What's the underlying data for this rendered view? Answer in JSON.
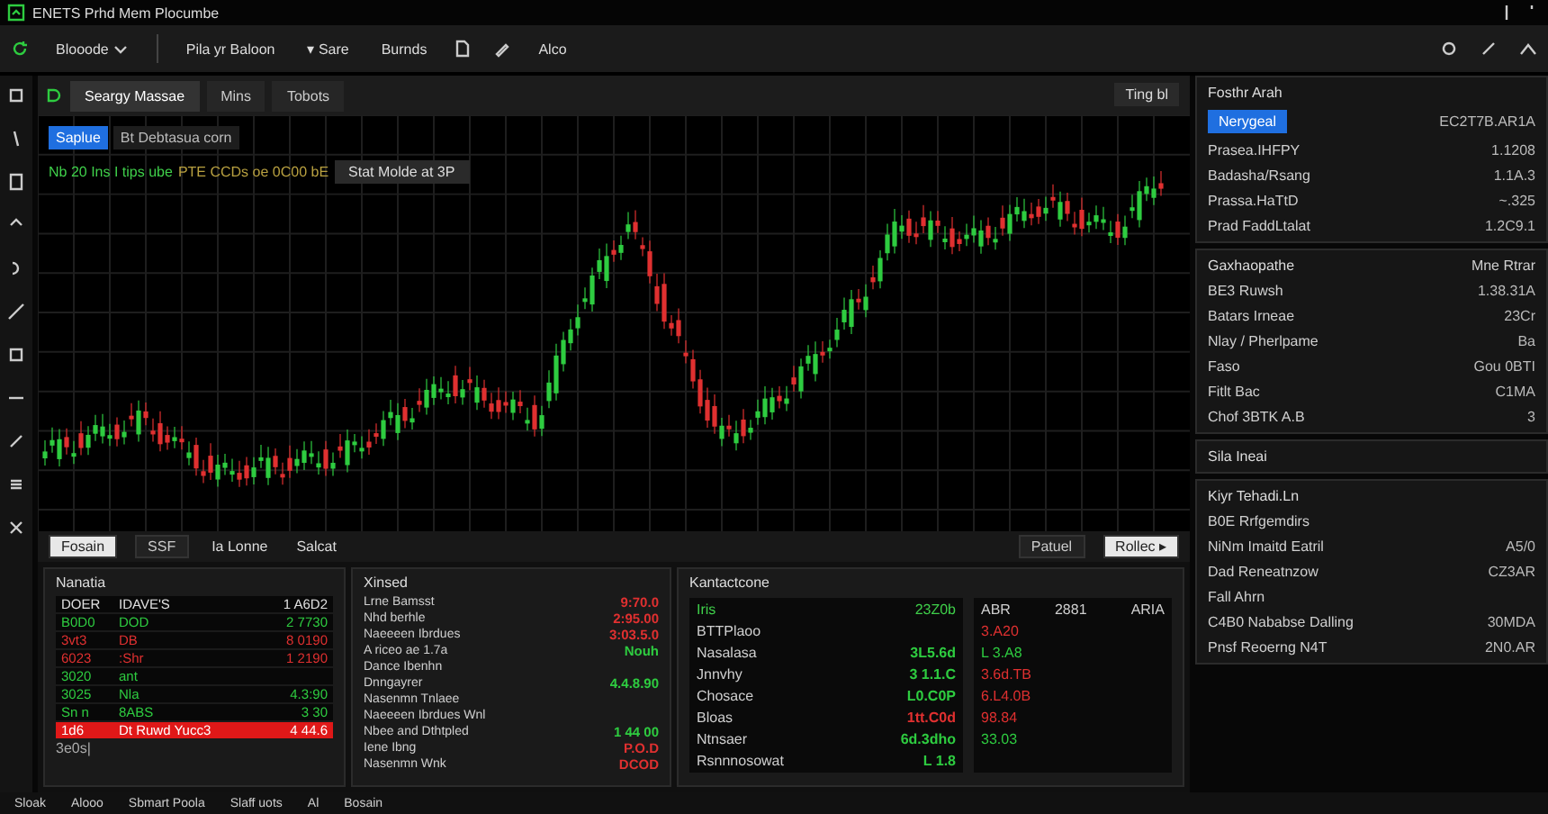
{
  "window": {
    "title": "ENETS Prhd Mem Plocumbe"
  },
  "toolbar": {
    "items": [
      {
        "label": "Blooode",
        "kind": "dropdown"
      },
      {
        "label": "Pila yr Baloon",
        "kind": "button"
      },
      {
        "label": "▾ Sare",
        "kind": "button"
      },
      {
        "label": "Burnds",
        "kind": "button"
      },
      {
        "label": "Alco",
        "kind": "button"
      }
    ]
  },
  "chart_panel": {
    "tabs": [
      {
        "label": "Seargy Massae",
        "selected": true
      },
      {
        "label": "Mins",
        "selected": false
      },
      {
        "label": "Tobots",
        "selected": false
      }
    ],
    "symbol_tag": "Saplue",
    "symbol_name": "Bt Debtasua corn",
    "legend": "Nb 20 Ins I tips ube",
    "legend_value": "PTE CCDs oe 0C00 bE",
    "mode_button": "Stat Molde at 3P",
    "header_button": "Ting bl"
  },
  "bottom_toolbar": {
    "left": [
      {
        "label": "Fosain",
        "selected": true
      },
      {
        "label": "SSF",
        "selected": false
      }
    ],
    "middle": [
      {
        "label": "Ia Lonne"
      },
      {
        "label": "Salcat"
      }
    ],
    "right": [
      {
        "label": "Patuel",
        "selected": false
      },
      {
        "label": "Rollec ▸",
        "selected": true
      }
    ]
  },
  "watchlist": {
    "title": "Nanatia",
    "rows": [
      {
        "code": "DOER",
        "name": "IDAVE'S",
        "price": "1 A6D2",
        "color": "#e0e0e0",
        "selected": false
      },
      {
        "code": "B0D0",
        "name": "DOD",
        "price": "2 7730",
        "color": "#2ecc40",
        "selected": false
      },
      {
        "code": "3vt3",
        "name": "DB",
        "price": "8 0190",
        "color": "#e03030",
        "selected": false
      },
      {
        "code": "6023",
        "name": ":Shr",
        "price": "1 2190",
        "color": "#e03030",
        "selected": false
      },
      {
        "code": "3020",
        "name": "ant",
        "price": "",
        "color": "#2ecc40",
        "selected": false
      },
      {
        "code": "3025",
        "name": "Nla",
        "price": "4.3:90",
        "color": "#2ecc40",
        "selected": false
      },
      {
        "code": "Sn n",
        "name": "8ABS",
        "price": "3 30",
        "color": "#2ecc40",
        "selected": false
      },
      {
        "code": "1d6",
        "name": "Dt Ruwd Yucc3",
        "price": "4 44.6",
        "selected": true
      }
    ],
    "footer": "3e0s|"
  },
  "orders": {
    "title": "Xinsed",
    "rows": [
      {
        "label": "Lrne    Bamsst",
        "value": "9:70.0",
        "color": "#e03030"
      },
      {
        "label": "Nhd berhle",
        "value": "2:95.00",
        "color": "#e03030"
      },
      {
        "label": "Naeeeen  Ibrdues",
        "value": "3:03.5.0",
        "color": "#e03030"
      },
      {
        "label": "A riceo ae 1.7a",
        "value": "Nouh",
        "color": "#2ecc40"
      },
      {
        "label": "Dance  Ibenhn",
        "value": ""
      },
      {
        "label": "Dnngayrer",
        "value": "4.4.8.90",
        "color": "#2ecc40"
      },
      {
        "label": "Nasenmn  Tnlaee",
        "value": ""
      },
      {
        "label": "Naeeeen  Ibrdues  Wnl",
        "value": ""
      },
      {
        "label": "Nbee  and  Dthtpled",
        "value": "1 44 00",
        "color": "#2ecc40"
      },
      {
        "label": "Iene  Ibng",
        "value": "P.O.D",
        "color": "#e03030"
      },
      {
        "label": "Nasenmn  Wnk",
        "value": "DCOD",
        "color": "#e03030"
      }
    ]
  },
  "transactions": {
    "title": "Kantactcone",
    "columns": [
      "Iris",
      "23Z0b"
    ],
    "rows": [
      {
        "name": "BTTPlaoo",
        "value": ""
      },
      {
        "name": "Nasalasa",
        "value": "3L5.6d",
        "color": "#2ecc40"
      },
      {
        "name": "Jnnvhy",
        "value": "3 1.1.C",
        "color": "#2ecc40"
      },
      {
        "name": "Chosace",
        "value": "L0.C0P",
        "color": "#2ecc40"
      },
      {
        "name": "Bloas",
        "value": "1tt.C0d",
        "color": "#e03030"
      },
      {
        "name": "Ntnsaer",
        "value": "6d.3dho",
        "color": "#2ecc40"
      },
      {
        "name": "Rsnnnosowat",
        "value": "L 1.8",
        "color": "#2ecc40"
      }
    ],
    "side_columns": [
      "ABR",
      "2881",
      "ARIA"
    ],
    "side_rows": [
      {
        "value": "3.A20",
        "color": "#e03030"
      },
      {
        "value": "L 3.A8",
        "color": "#2ecc40"
      },
      {
        "value": "3.6d.TB",
        "color": "#e03030"
      },
      {
        "value": "6.L4.0B",
        "color": "#e03030"
      },
      {
        "value": "98.84",
        "color": "#e03030"
      },
      {
        "value": "33.03",
        "color": "#2ecc40"
      }
    ]
  },
  "status_bar": [
    "Sloak",
    "Alooo",
    "Sbmart Poola",
    "Slaff uots",
    "Al",
    "Bosain"
  ],
  "sidebar": {
    "sections": [
      {
        "title": "Fosthr Arah",
        "rows": [
          {
            "tag": "Nerygeal",
            "name": "",
            "value": "EC2T7B.AR1A"
          },
          {
            "tag": "",
            "name": "Prasea.IHFPY",
            "value": "1.1208"
          },
          {
            "tag": "",
            "name": "Badasha/Rsang",
            "value": "1.1A.3"
          },
          {
            "tag": "",
            "name": "Prassa.HaTtD",
            "value": "~.325"
          },
          {
            "tag": "",
            "name": "Prad FaddLtalat",
            "value": "1.2C9.1"
          }
        ]
      },
      {
        "title": "Gaxhaopathe",
        "right": "Mne Rtrar",
        "rows": [
          {
            "tag": "",
            "name": "BE3 Ruwsh",
            "value": "1.38.31A"
          },
          {
            "tag": "",
            "name": "Batars Irneae",
            "value": "23Cr"
          },
          {
            "tag": "",
            "name": "Nlay  /  Pherlpame",
            "value": "Ba"
          },
          {
            "tag": "",
            "name": "Faso",
            "value": "Gou 0BTI"
          },
          {
            "tag": "",
            "name": "Fitlt Bac",
            "value": "C1MA"
          },
          {
            "tag": "",
            "name": "Chof 3BTK A.B",
            "value": "3"
          }
        ]
      },
      {
        "title": "Sila Ineai"
      },
      {
        "title": "Kiyr Tehadi.Ln",
        "rows": [
          {
            "tag": "",
            "name": "B0E Rrfgemdirs",
            "value": ""
          },
          {
            "tag": "",
            "name": "NiNm  Imaitd Eatril",
            "value": "A5/0"
          },
          {
            "tag": "",
            "name": "Dad Reneatnzow",
            "value": "CZ3AR"
          },
          {
            "tag": "",
            "name": "Fall Ahrn",
            "value": ""
          },
          {
            "tag": "",
            "name": "C4B0 Nababse Dalling",
            "value": "30MDA"
          },
          {
            "tag": "",
            "name": "Pnsf Reoerng N4T",
            "value": "2N0.AR"
          }
        ]
      }
    ]
  }
}
